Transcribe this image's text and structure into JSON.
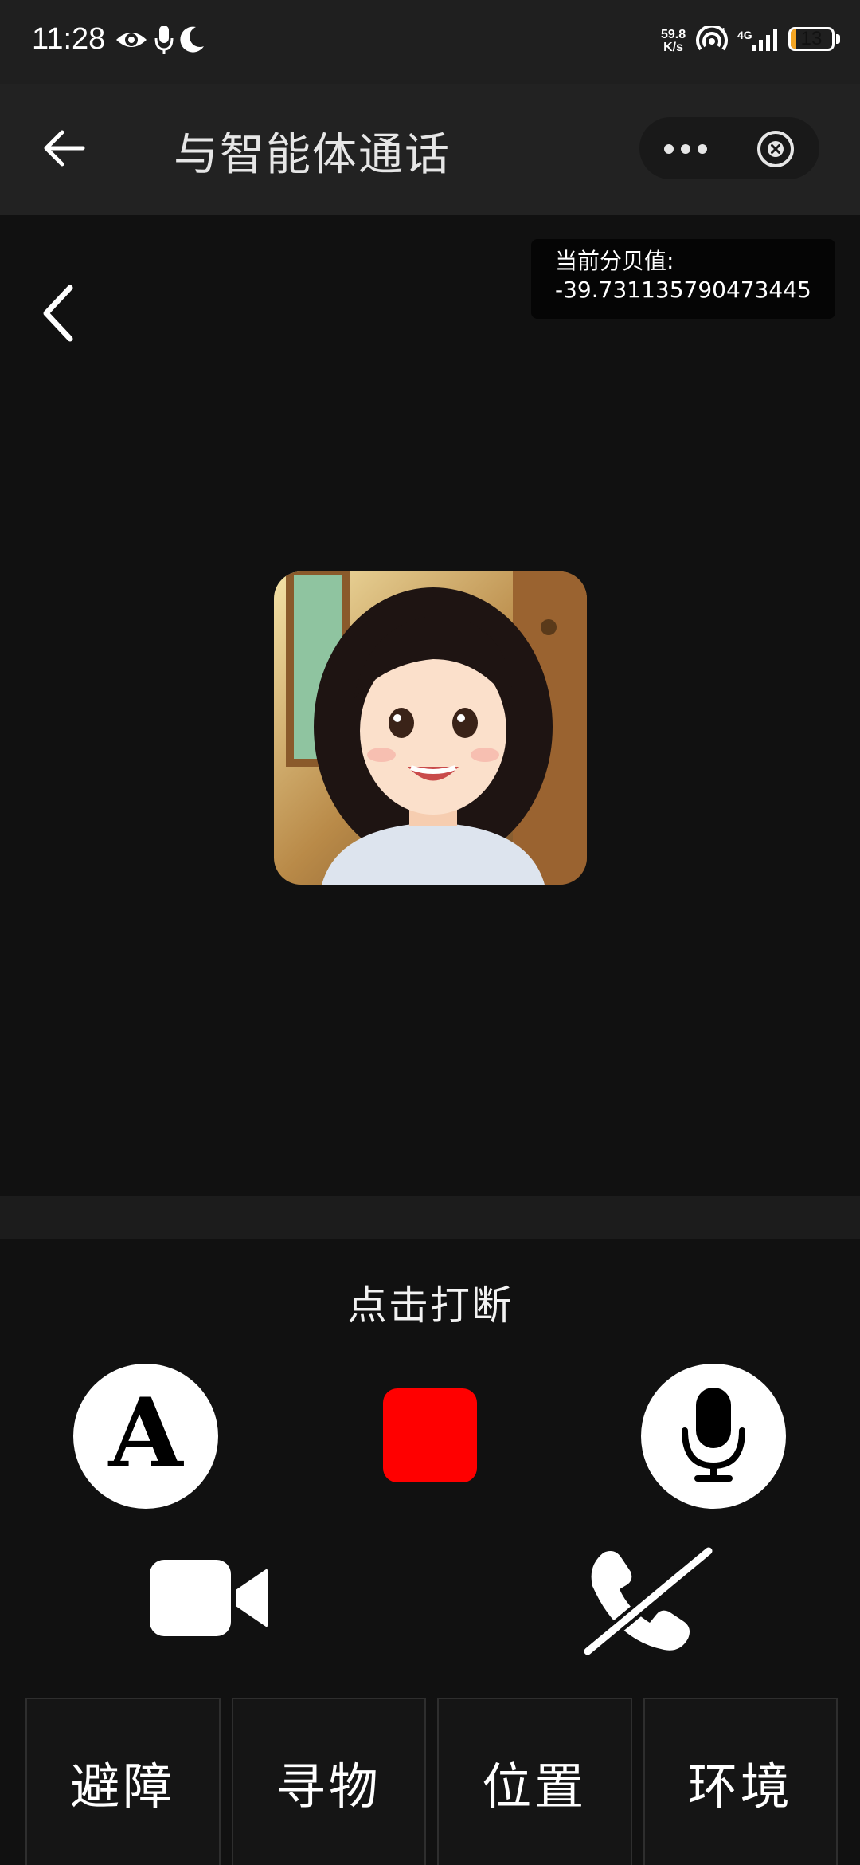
{
  "status_bar": {
    "time": "11:28",
    "net_speed_value": "59.8",
    "net_speed_unit": "K/s",
    "network_type": "4G",
    "battery_level": "13",
    "battery_fraction": 0.13,
    "battery_color": "#f5a623"
  },
  "header": {
    "title": "与智能体通话"
  },
  "main": {
    "decibel_label": "当前分贝值:",
    "decibel_value": "-39.731135790473445"
  },
  "controls": {
    "interrupt_hint": "点击打断",
    "stop_color": "#ff0000"
  },
  "tabs": [
    {
      "label": "避障"
    },
    {
      "label": "寻物"
    },
    {
      "label": "位置"
    },
    {
      "label": "环境"
    }
  ],
  "icons": [
    "eye-icon",
    "mic-status-icon",
    "moon-icon",
    "hotspot-icon",
    "signal-icon",
    "back-arrow-icon",
    "more-icon",
    "close-circle-icon",
    "chevron-left-icon",
    "font-icon",
    "mic-icon",
    "video-camera-icon",
    "hang-up-icon"
  ]
}
